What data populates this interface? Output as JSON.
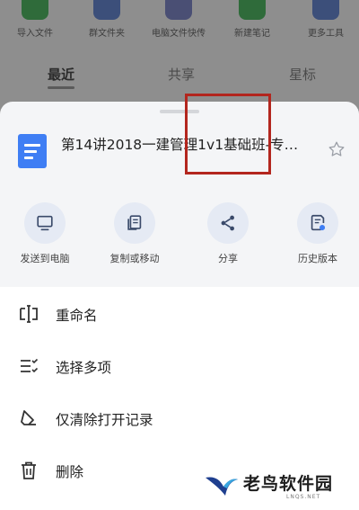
{
  "background": {
    "tools": [
      {
        "label": "导入文件",
        "color": "#2f6b3a"
      },
      {
        "label": "群文件夹",
        "color": "#3c4f7a"
      },
      {
        "label": "电脑文件快传",
        "color": "#4a4f74"
      },
      {
        "label": "新建笔记",
        "color": "#2f6b3a"
      },
      {
        "label": "更多工具",
        "color": "#3c4f7a"
      }
    ],
    "tabs": [
      {
        "label": "最近"
      },
      {
        "label": "共享"
      },
      {
        "label": "星标"
      }
    ]
  },
  "sheet": {
    "file_title": "第14讲2018一建管理1v1基础班-专…",
    "actions": [
      {
        "label": "发送到电脑",
        "icon": "monitor-icon"
      },
      {
        "label": "复制或移动",
        "icon": "copy-icon"
      },
      {
        "label": "分享",
        "icon": "share-icon"
      },
      {
        "label": "历史版本",
        "icon": "history-version-icon"
      }
    ],
    "list": [
      {
        "label": "重命名",
        "icon": "rename-icon"
      },
      {
        "label": "选择多项",
        "icon": "multi-select-icon"
      },
      {
        "label": "仅清除打开记录",
        "icon": "eraser-icon"
      },
      {
        "label": "删除",
        "icon": "trash-icon"
      }
    ]
  },
  "watermark": {
    "text": "老鸟软件园",
    "sub": "LNQS.NET"
  },
  "colors": {
    "accent": "#3f7ef4",
    "highlight": "#b3261e"
  }
}
